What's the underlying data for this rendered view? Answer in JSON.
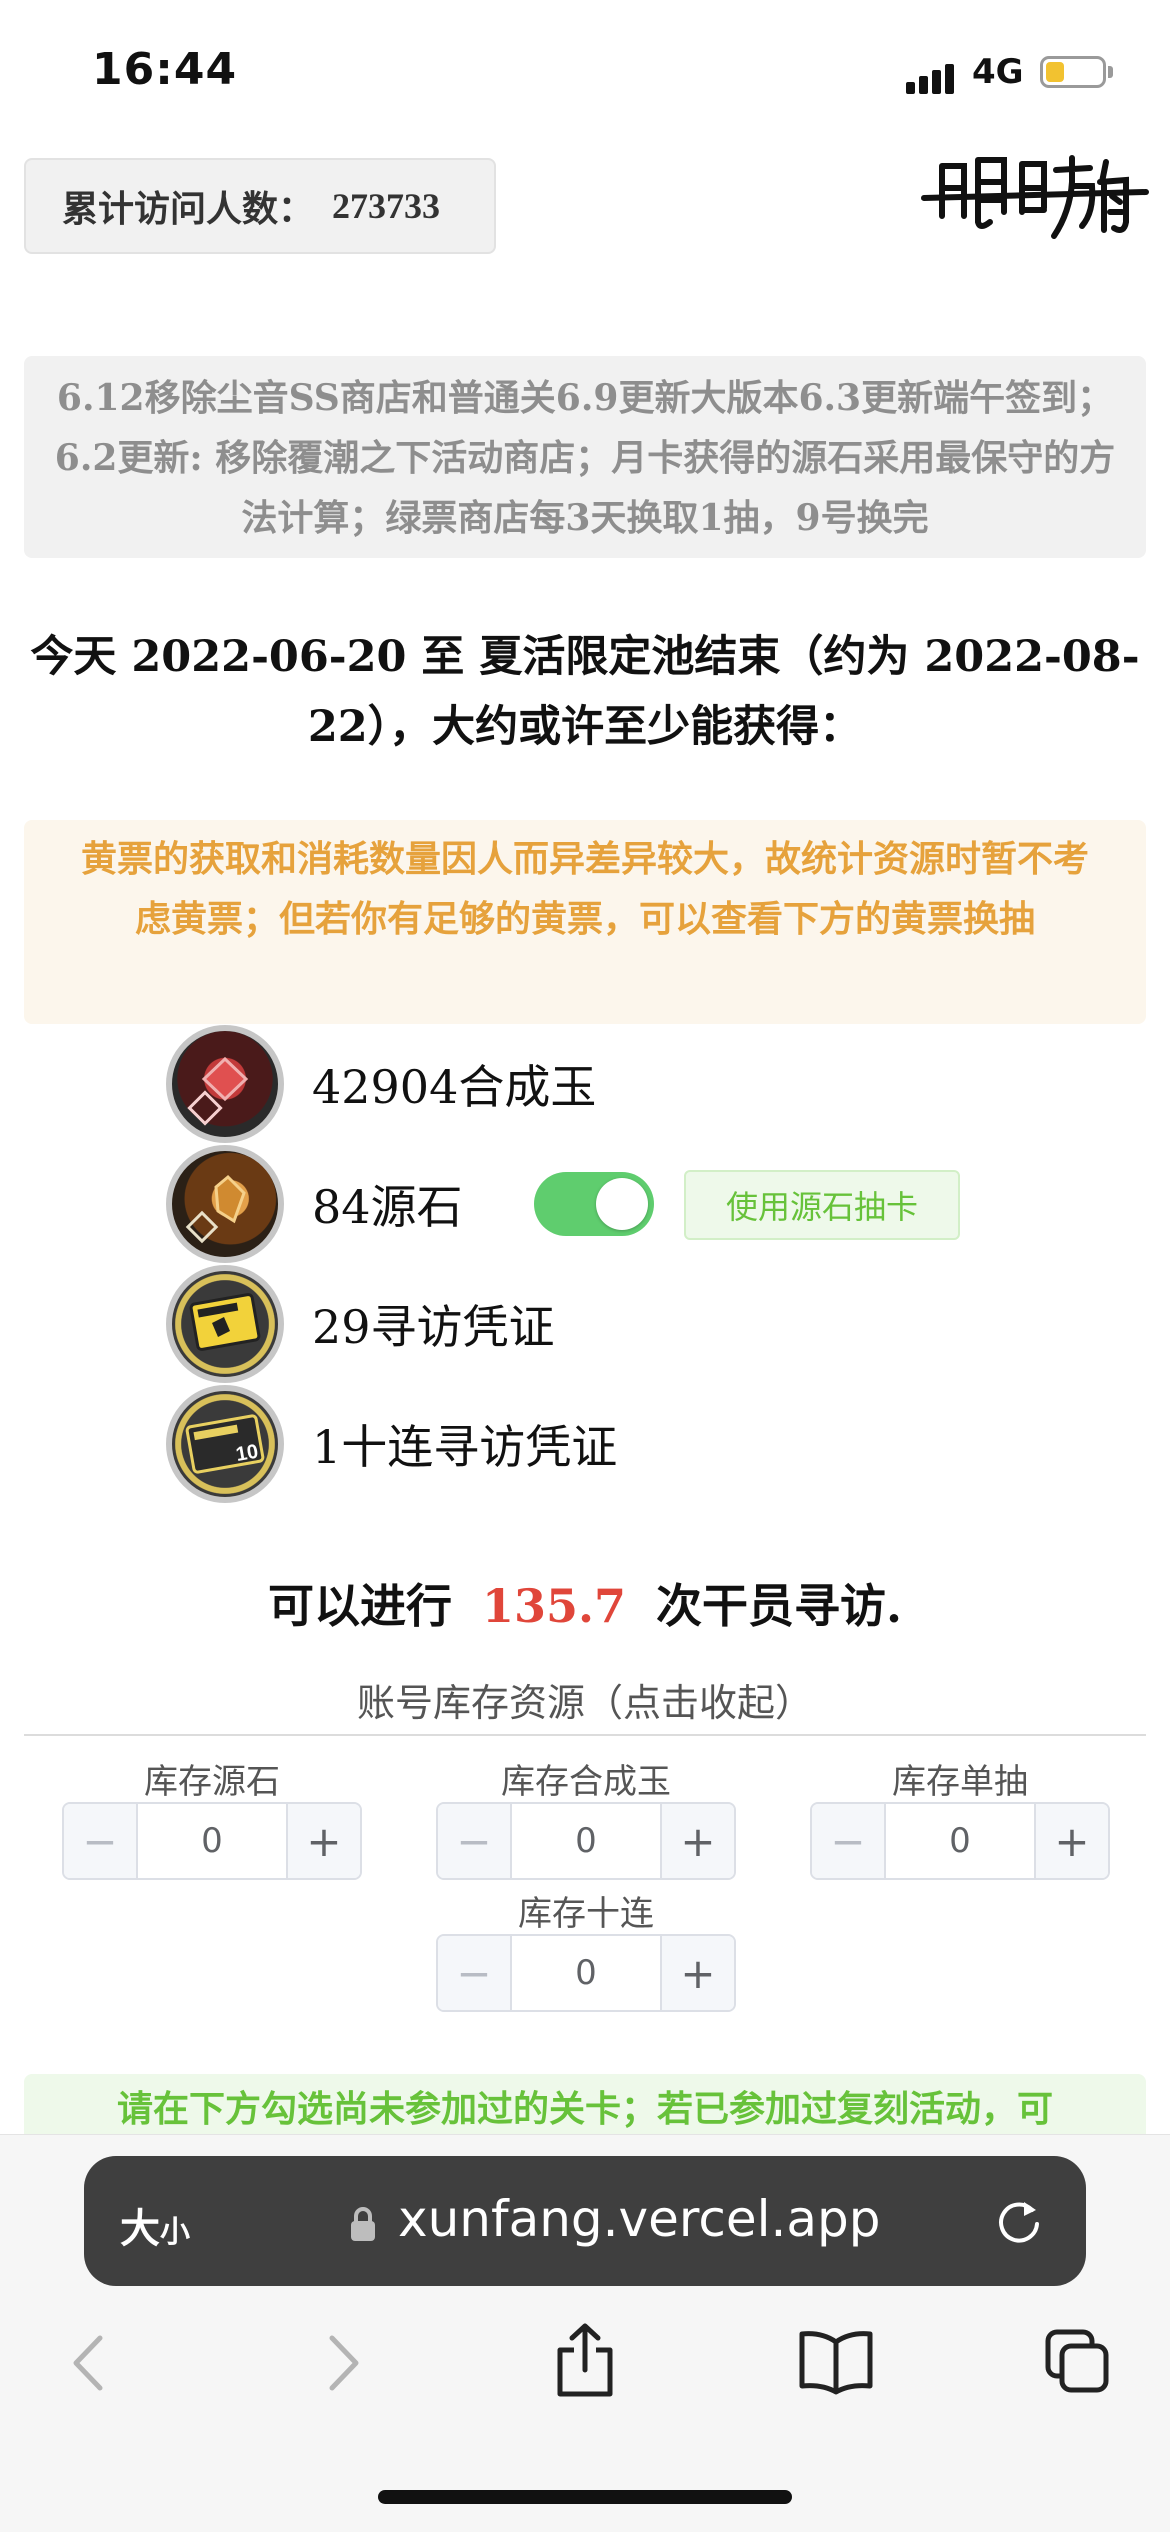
{
  "status_bar": {
    "time": "16:44",
    "network": "4G"
  },
  "visitor": {
    "label": "累计访问人数：",
    "count": "273733"
  },
  "logo_text": "明日方舟",
  "notice": "6.12移除尘音SS商店和普通关6.9更新大版本6.3更新端午签到；6.2更新: 移除覆潮之下活动商店；月卡获得的源石采用最保守的方法计算；绿票商店每3天换取1抽，9号换完",
  "headline": "今天 2022-06-20 至 夏活限定池结束（约为 2022-08-22），大约或许至少能获得：",
  "warning": "黄票的获取和消耗数量因人而异差异较大，故统计资源时暂不考虑黄票；但若你有足够的黄票，可以查看下方的黄票换抽",
  "resources": [
    {
      "label": "42904合成玉",
      "icon": "orundum-icon"
    },
    {
      "label": "84源石",
      "icon": "originite-icon"
    },
    {
      "label": "29寻访凭证",
      "icon": "headhunting-permit-icon"
    },
    {
      "label": "1十连寻访凭证",
      "icon": "ten-pull-permit-icon"
    }
  ],
  "use_originite": {
    "toggle_on": true,
    "button_label": "使用源石抽卡"
  },
  "result": {
    "prefix": "可以进行",
    "value": "135.7",
    "suffix": "次干员寻访."
  },
  "inventory": {
    "title": "账号库存资源（点击收起）",
    "fields": [
      {
        "label": "库存源石",
        "value": "0"
      },
      {
        "label": "库存合成玉",
        "value": "0"
      },
      {
        "label": "库存单抽",
        "value": "0"
      },
      {
        "label": "库存十连",
        "value": "0"
      }
    ],
    "minus": "−",
    "plus": "+"
  },
  "green_note": "请在下方勾选尚未参加过的关卡；若已参加过复刻活动，可",
  "browser": {
    "text_size": "大",
    "text_size_small": "小",
    "url": "xunfang.vercel.app"
  },
  "colors": {
    "accent_green": "#5fcd6e",
    "warning_orange": "#e6a23c",
    "result_red": "#e0463a"
  }
}
